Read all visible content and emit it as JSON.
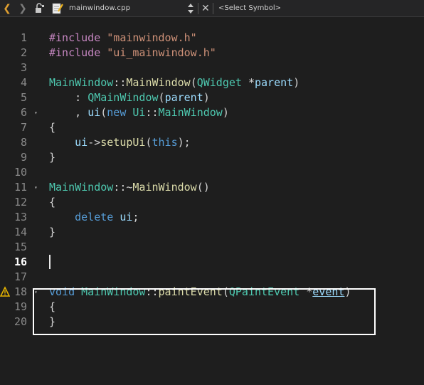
{
  "toolbar": {
    "back_icon": "chevron-left-icon",
    "forward_icon": "chevron-right-icon",
    "lock_icon": "lock-icon",
    "file_icon": "document-icon",
    "file_name": "mainwindow.cpp",
    "close_icon": "close-icon",
    "symbol_placeholder": "<Select Symbol>"
  },
  "editor": {
    "current_line": 16,
    "warning_line": 18,
    "highlight_color": "#ffffff",
    "lines": [
      {
        "n": "1",
        "fold": "",
        "tokens": [
          [
            "pp",
            "#include"
          ],
          [
            "op",
            " "
          ],
          [
            "str",
            "\"mainwindow.h\""
          ]
        ]
      },
      {
        "n": "2",
        "fold": "",
        "tokens": [
          [
            "pp",
            "#include"
          ],
          [
            "op",
            " "
          ],
          [
            "str",
            "\"ui_mainwindow.h\""
          ]
        ]
      },
      {
        "n": "3",
        "fold": "",
        "tokens": []
      },
      {
        "n": "4",
        "fold": "",
        "tokens": [
          [
            "type",
            "MainWindow"
          ],
          [
            "op",
            "::"
          ],
          [
            "fn",
            "MainWindow"
          ],
          [
            "op",
            "("
          ],
          [
            "type",
            "QWidget"
          ],
          [
            "op",
            " *"
          ],
          [
            "var",
            "parent"
          ],
          [
            "op",
            ")"
          ]
        ]
      },
      {
        "n": "5",
        "fold": "",
        "tokens": [
          [
            "op",
            "    : "
          ],
          [
            "type",
            "QMainWindow"
          ],
          [
            "op",
            "("
          ],
          [
            "var",
            "parent"
          ],
          [
            "op",
            ")"
          ]
        ]
      },
      {
        "n": "6",
        "fold": "▾",
        "tokens": [
          [
            "op",
            "    , "
          ],
          [
            "var",
            "ui"
          ],
          [
            "op",
            "("
          ],
          [
            "kw",
            "new"
          ],
          [
            "op",
            " "
          ],
          [
            "ns",
            "Ui"
          ],
          [
            "op",
            "::"
          ],
          [
            "type",
            "MainWindow"
          ],
          [
            "op",
            ")"
          ]
        ]
      },
      {
        "n": "7",
        "fold": "",
        "tokens": [
          [
            "op",
            "{"
          ]
        ]
      },
      {
        "n": "8",
        "fold": "",
        "tokens": [
          [
            "op",
            "    "
          ],
          [
            "var",
            "ui"
          ],
          [
            "op",
            "->"
          ],
          [
            "fn",
            "setupUi"
          ],
          [
            "op",
            "("
          ],
          [
            "kw",
            "this"
          ],
          [
            "op",
            ");"
          ]
        ]
      },
      {
        "n": "9",
        "fold": "",
        "tokens": [
          [
            "op",
            "}"
          ]
        ]
      },
      {
        "n": "10",
        "fold": "",
        "tokens": []
      },
      {
        "n": "11",
        "fold": "▾",
        "tokens": [
          [
            "type",
            "MainWindow"
          ],
          [
            "op",
            "::~"
          ],
          [
            "fn",
            "MainWindow"
          ],
          [
            "op",
            "()"
          ]
        ]
      },
      {
        "n": "12",
        "fold": "",
        "tokens": [
          [
            "op",
            "{"
          ]
        ]
      },
      {
        "n": "13",
        "fold": "",
        "tokens": [
          [
            "op",
            "    "
          ],
          [
            "kw",
            "delete"
          ],
          [
            "op",
            " "
          ],
          [
            "var",
            "ui"
          ],
          [
            "op",
            ";"
          ]
        ]
      },
      {
        "n": "14",
        "fold": "",
        "tokens": [
          [
            "op",
            "}"
          ]
        ]
      },
      {
        "n": "15",
        "fold": "",
        "tokens": []
      },
      {
        "n": "16",
        "fold": "",
        "tokens": []
      },
      {
        "n": "17",
        "fold": "",
        "tokens": []
      },
      {
        "n": "18",
        "fold": "▾",
        "tokens": [
          [
            "kw",
            "void"
          ],
          [
            "op",
            " "
          ],
          [
            "type",
            "MainWindow"
          ],
          [
            "op",
            "::"
          ],
          [
            "fn",
            "paintEvent"
          ],
          [
            "op",
            "("
          ],
          [
            "type",
            "QPaintEvent"
          ],
          [
            "op",
            " *"
          ],
          [
            "var ul",
            "event"
          ],
          [
            "op",
            ")"
          ]
        ]
      },
      {
        "n": "19",
        "fold": "",
        "tokens": [
          [
            "op",
            "{"
          ]
        ]
      },
      {
        "n": "20",
        "fold": "",
        "tokens": [
          [
            "op",
            "}"
          ]
        ]
      }
    ]
  }
}
